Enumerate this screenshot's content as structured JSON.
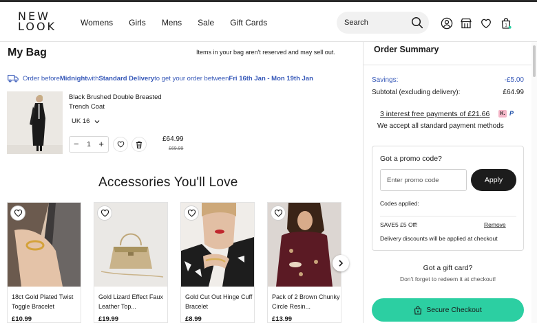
{
  "header": {
    "logo_line1": "NEW",
    "logo_line2": "LOOK",
    "nav": [
      "Womens",
      "Girls",
      "Mens",
      "Sale",
      "Gift Cards"
    ],
    "search_placeholder": "Search",
    "bag_count": "1"
  },
  "bag": {
    "title": "My Bag",
    "note": "Items in your bag aren't reserved and may sell out.",
    "delivery": {
      "pre": "Order before ",
      "bold1": "Midnight",
      "mid": " with ",
      "bold2": "Standard Delivery",
      "mid2": " to get your order between ",
      "bold3": "Fri 16th Jan - Mon 19th Jan"
    },
    "item": {
      "name": "Black Brushed Double Breasted Trench Coat",
      "size": "UK 16",
      "quantity": "1",
      "price": "£64.99",
      "was_price": "£69.99"
    }
  },
  "accessories": {
    "title": "Accessories You'll Love",
    "products": [
      {
        "name": "18ct Gold Plated Twist Toggle Bracelet",
        "price": "£10.99"
      },
      {
        "name": "Gold Lizard Effect Faux Leather Top...",
        "price": "£19.99"
      },
      {
        "name": "Gold Cut Out Hinge Cuff Bracelet",
        "price": "£8.99"
      },
      {
        "name": "Pack of 2 Brown Chunky Circle Resin...",
        "price": "£13.99"
      }
    ]
  },
  "summary": {
    "title": "Order Summary",
    "savings_label": "Savings:",
    "savings_value": "-£5.00",
    "subtotal_label": "Subtotal (excluding delivery):",
    "subtotal_value": "£64.99",
    "klarna_text": "3 interest free payments of £21.66",
    "klarna_badge": "K.",
    "paypal_badge": "P",
    "payments_text": "We accept all standard payment methods",
    "promo": {
      "title": "Got a promo code?",
      "placeholder": "Enter promo code",
      "apply_label": "Apply",
      "codes_applied": "Codes applied:",
      "code_name": "SAVE5 £5 Off!",
      "remove_label": "Remove",
      "delivery_note": "Delivery discounts will be applied at checkout"
    },
    "gift_title": "Got a gift card?",
    "gift_sub": "Don't forget to redeem it at checkout!",
    "checkout_label": "Secure Checkout"
  },
  "colors": {
    "accent_blue": "#3658b8",
    "checkout_green": "#2ccfa2",
    "dark_button": "#1c1c1c"
  }
}
